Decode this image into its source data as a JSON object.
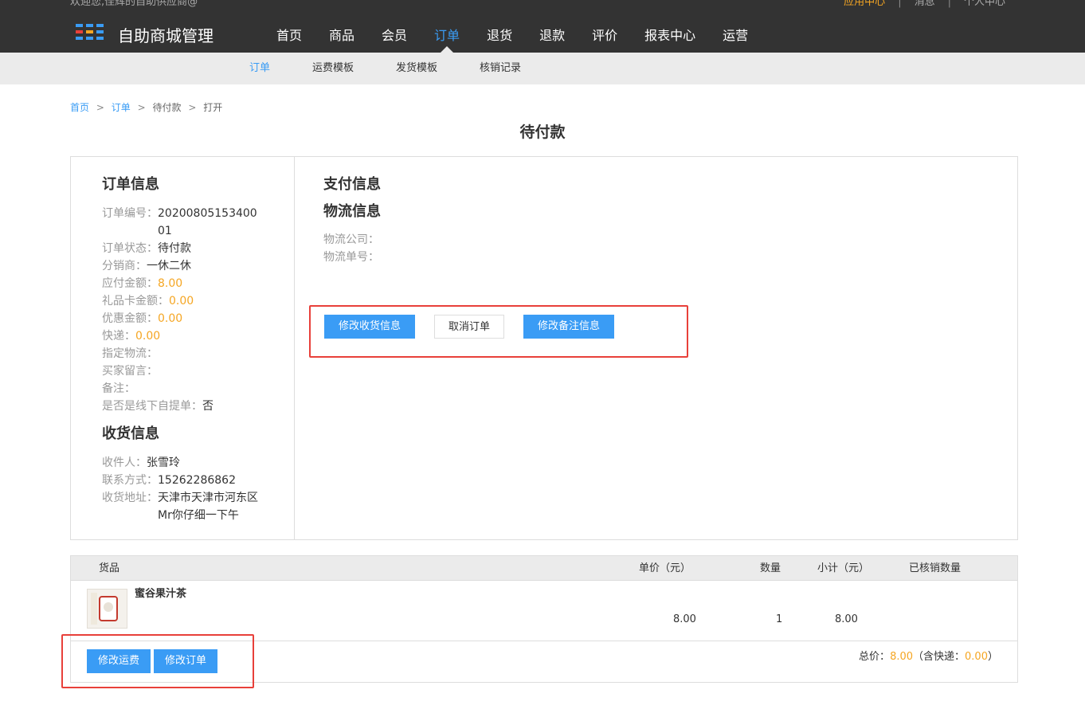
{
  "header": {
    "welcome": "欢迎您,佳辉的自助供应商@",
    "links": [
      "应用中心",
      "消息",
      "个人中心"
    ],
    "separator": "|",
    "brand": "自助商城管理",
    "nav": [
      "首页",
      "商品",
      "会员",
      "订单",
      "退货",
      "退款",
      "评价",
      "报表中心",
      "运营"
    ]
  },
  "subnav": [
    "订单",
    "运费模板",
    "发货模板",
    "核销记录"
  ],
  "breadcrumb": {
    "home": "首页",
    "sep": ">",
    "order": "订单",
    "pending": "待付款",
    "open": "打开"
  },
  "page_title": "待付款",
  "order_info": {
    "heading": "订单信息",
    "order_no_label": "订单编号：",
    "order_no_value": "2020080515340001",
    "status_label": "订单状态：",
    "status_value": "待付款",
    "distributor_label": "分销商：",
    "distributor_value": "一休二休",
    "payable_label": "应付金额：",
    "payable_value": "8.00",
    "giftcard_label": "礼品卡金额：",
    "giftcard_value": "0.00",
    "discount_label": "优惠金额：",
    "discount_value": "0.00",
    "express_label": "快递：",
    "express_value": "0.00",
    "logistics_assigned_label": "指定物流：",
    "buyer_msg_label": "买家留言：",
    "remark_label": "备注：",
    "self_pickup_label": "是否是线下自提单：",
    "self_pickup_value": "否"
  },
  "receiver": {
    "heading": "收货信息",
    "name_label": "收件人：",
    "name_value": "张雪玲",
    "phone_label": "联系方式：",
    "phone_value": "15262286862",
    "address_label": "收货地址：",
    "address_value": "天津市天津市河东区Mr你仔细一下午"
  },
  "payment": {
    "heading": "支付信息"
  },
  "logistics": {
    "heading": "物流信息",
    "company_label": "物流公司：",
    "tracking_label": "物流单号："
  },
  "actions": {
    "edit_shipping": "修改收货信息",
    "cancel_order": "取消订单",
    "edit_remark": "修改备注信息"
  },
  "goods_table": {
    "headers": [
      "货品",
      "单价（元）",
      "数量",
      "小计（元）",
      "已核销数量"
    ],
    "rows": [
      {
        "name": "蜜谷果汁茶",
        "price": "8.00",
        "qty": "1",
        "subtotal": "8.00",
        "verified": ""
      }
    ]
  },
  "bottom_actions": {
    "edit_freight": "修改运费",
    "edit_order": "修改订单"
  },
  "total": {
    "label": "总价：",
    "value": "8.00",
    "express_prefix": "（含快递：",
    "express_value": "0.00",
    "suffix": "）"
  },
  "colors": {
    "accent": "#3a9cf5",
    "orange": "#f5a623",
    "highlight": "#e8403a",
    "topbar": "#333333"
  }
}
